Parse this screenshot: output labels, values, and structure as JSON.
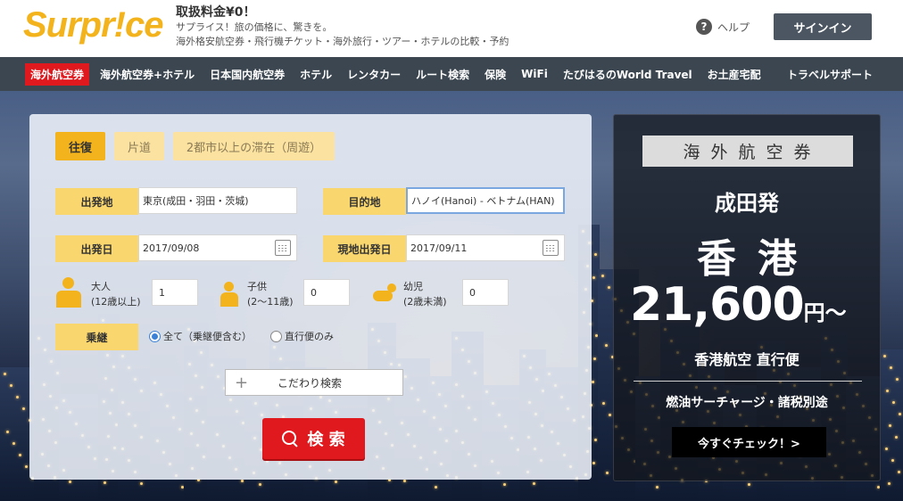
{
  "header": {
    "logo": "Surpr!ce",
    "tagline_title": "取扱料金¥0！",
    "tagline_line1": "サプライス！旅の価格に、驚きを。",
    "tagline_line2": "海外格安航空券・飛行機チケット・海外旅行・ツアー・ホテルの比較・予約",
    "help_label": "ヘルプ",
    "signin_label": "サインイン"
  },
  "nav": {
    "items": [
      "海外航空券",
      "海外航空券+ホテル",
      "日本国内航空券",
      "ホテル",
      "レンタカー",
      "ルート検索",
      "保険",
      "WiFi",
      "たびはるのWorld Travel",
      "お土産宅配"
    ],
    "support": "トラベルサポート"
  },
  "search": {
    "trip_types": [
      "往復",
      "片道",
      "2都市以上の滞在（周遊）"
    ],
    "origin_label": "出発地",
    "origin_value": "東京(成田・羽田・茨城)",
    "dest_label": "目的地",
    "dest_value": "ハノイ(Hanoi) - ベトナム(HAN)",
    "depart_label": "出発日",
    "depart_value": "2017/09/08",
    "return_label": "現地出発日",
    "return_value": "2017/09/11",
    "adult_label": "大人",
    "adult_sub": "(12歳以上)",
    "adult_value": "1",
    "child_label": "子供",
    "child_sub": "(2〜11歳)",
    "child_value": "0",
    "infant_label": "幼児",
    "infant_sub": "(2歳未満)",
    "infant_value": "0",
    "transit_label": "乗継",
    "transit_all": "全て（乗継便含む）",
    "transit_direct": "直行便のみ",
    "advanced_label": "こだわり検索",
    "search_label": "検 索"
  },
  "promo": {
    "tag": "海外航空券",
    "origin": "成田発",
    "destination": "香港",
    "price": "21,600",
    "price_unit": "円〜",
    "airline": "香港航空 直行便",
    "note": "燃油サーチャージ・諸税別途",
    "cta": "今すぐチェック！>"
  },
  "colors": {
    "brand": "#f3b31c",
    "accent_red": "#e0191e",
    "nav_bg": "#3b4650"
  }
}
